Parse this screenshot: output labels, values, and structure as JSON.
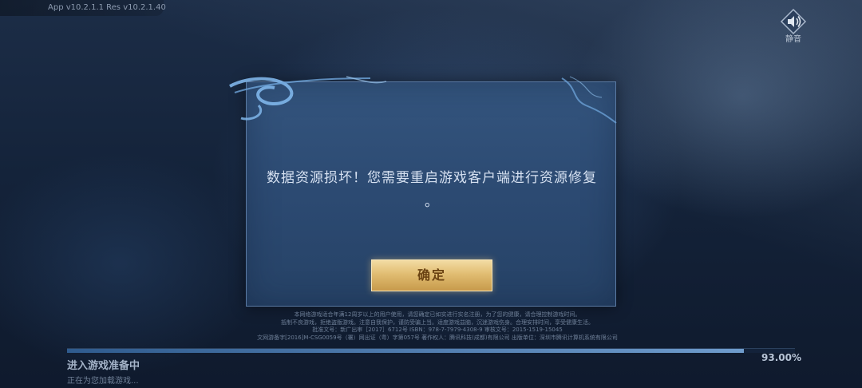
{
  "header": {
    "version_text": "App v10.2.1.1   Res v10.2.1.40"
  },
  "sound": {
    "label": "静音",
    "icon": "speaker-icon"
  },
  "dialog": {
    "message_line1": "数据资源损坏！您需要重启游戏客户端进行资源修复",
    "message_line2": "。",
    "confirm_label": "确定",
    "accent_color": "#e1bd72"
  },
  "notice": {
    "lines": [
      "本网络游戏适合年满12周岁以上的用户使用，请您确定已如实进行实名注册，为了您的健康，请合理控制游戏时间。",
      "抵制不良游戏，拒绝盗版游戏。注意自我保护，谨防受骗上当。适度游戏益脑，沉迷游戏伤身。合理安排时间，享受健康生活。",
      "批准文号：新广出审［2017］6712号  ISBN：978-7-7979-4308-9  审核文号：2015-1519-15045",
      "文网游备字[2016]M-CSG0059号（署）网出证（粤）字第057号  著作权人：腾讯科技(成都)有限公司  出版单位：深圳市腾讯计算机系统有限公司"
    ]
  },
  "loading": {
    "title": "进入游戏准备中",
    "subtitle": "正在为您加载游戏...",
    "percent_text": "93.00%",
    "progress_fraction": 0.93
  }
}
